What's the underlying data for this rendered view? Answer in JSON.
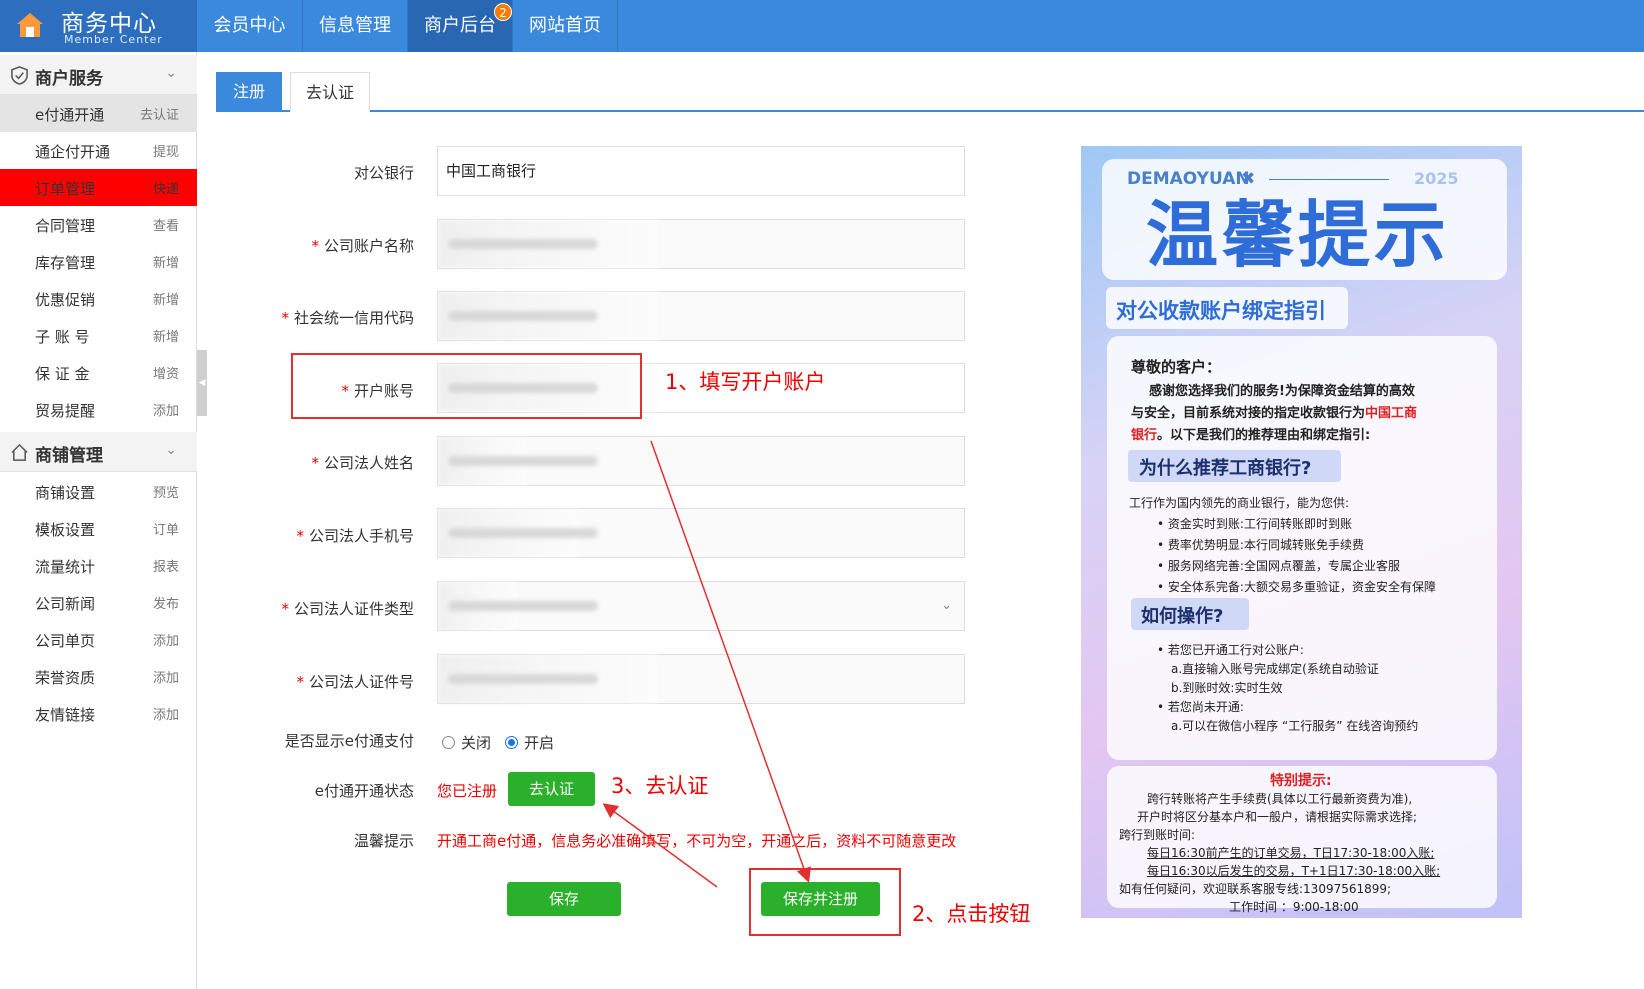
{
  "header": {
    "brand_title": "商务中心",
    "brand_subtitle": "Member Center",
    "nav": [
      {
        "label": "会员中心"
      },
      {
        "label": "信息管理"
      },
      {
        "label": "商户后台",
        "badge": "2"
      },
      {
        "label": "网站首页"
      }
    ]
  },
  "sidebar": {
    "sections": [
      {
        "title": "商户服务",
        "items": [
          {
            "label": "e付通开通",
            "action": "去认证"
          },
          {
            "label": "通企付开通",
            "action": "提现"
          },
          {
            "label": "订单管理",
            "action": "快递"
          },
          {
            "label": "合同管理",
            "action": "查看"
          },
          {
            "label": "库存管理",
            "action": "新增"
          },
          {
            "label": "优惠促销",
            "action": "新增"
          },
          {
            "label": "子 账 号",
            "action": "新增"
          },
          {
            "label": "保 证 金",
            "action": "增资"
          },
          {
            "label": "贸易提醒",
            "action": "添加"
          }
        ]
      },
      {
        "title": "商铺管理",
        "items": [
          {
            "label": "商铺设置",
            "action": "预览"
          },
          {
            "label": "模板设置",
            "action": "订单"
          },
          {
            "label": "流量统计",
            "action": "报表"
          },
          {
            "label": "公司新闻",
            "action": "发布"
          },
          {
            "label": "公司单页",
            "action": "添加"
          },
          {
            "label": "荣誉资质",
            "action": "添加"
          },
          {
            "label": "友情链接",
            "action": "添加"
          }
        ]
      }
    ]
  },
  "tabs": [
    {
      "label": "注册"
    },
    {
      "label": "去认证"
    }
  ],
  "form": {
    "bank_label": "对公银行",
    "bank_value": "中国工商银行",
    "required_mark": "*",
    "account_name_label": "公司账户名称",
    "credit_code_label": "社会统一信用代码",
    "account_no_label": "开户账号",
    "legal_name_label": "公司法人姓名",
    "legal_phone_label": "公司法人手机号",
    "id_type_label": "公司法人证件类型",
    "id_no_label": "公司法人证件号",
    "show_label": "是否显示e付通支付",
    "radio_off": "关闭",
    "radio_on": "开启",
    "radio_selected": "开启",
    "status_label": "e付通开通状态",
    "status_value": "您已注册",
    "verify_button": "去认证",
    "tip_label": "温馨提示",
    "tip_text": "开通工商e付通，信息务必准确填写，不可为空，开通之后，资料不可随意更改",
    "save_button": "保存",
    "save_register_button": "保存并注册"
  },
  "annotations": {
    "step1": "1、填写开户账户",
    "step2": "2、点击按钮",
    "step3": "3、去认证"
  },
  "poster": {
    "brand": "DEMAOYUAN",
    "year": "2025",
    "title": "温馨提示",
    "subtitle": "对公收款账户绑定指引",
    "greeting": "尊敬的客户：",
    "intro1": "感谢您选择我们的服务!为保障资金结算的高效",
    "intro2a": "与安全，目前系统对接的指定收款银行为",
    "intro2b": "中国工商",
    "intro3a": "银行",
    "intro3b": "。以下是我们的推荐理由和绑定指引:",
    "why_title": "为什么推荐工商银行?",
    "why_intro": "工行作为国内领先的商业银行，能为您供:",
    "why_items": [
      "资金实时到账:工行间转账即时到账",
      "费率优势明显:本行同城转账免手续费",
      "服务网络完善:全国网点覆盖，专属企业客服",
      "安全体系完备:大额交易多重验证，资金安全有保障"
    ],
    "how_title": "如何操作?",
    "how_lines": [
      "• 若您已开通工行对公账户:",
      "a.直接输入账号完成绑定(系统自动验证",
      "b.到账时效:实时生效",
      "• 若您尚未开通:",
      "a.可以在微信小程序 “工行服务” 在线咨询预约"
    ],
    "special_title": "特别提示:",
    "special_lines": [
      "跨行转账将产生手续费(具体以工行最新资费为准),",
      "开户时将区分基本户和一般户，请根据实际需求选择;",
      "跨行到账时间:",
      "每日16:30前产生的订单交易，T日17:30-18:00入账;",
      "每日16:30以后发生的交易，T+1日17:30-18:00入账;",
      "如有任何疑问，欢迎联系客服专线:13097561899;",
      "工作时间 ：9:00-18:00"
    ]
  },
  "colors": {
    "topbar": "#3a89dc",
    "brand_bg": "#2d6fbe",
    "active_nav": "#2a67b3",
    "badge": "#ff7a00",
    "primary_green": "#2bb02b",
    "highlight_red": "#ff0000",
    "annotation_red": "#e00000"
  }
}
